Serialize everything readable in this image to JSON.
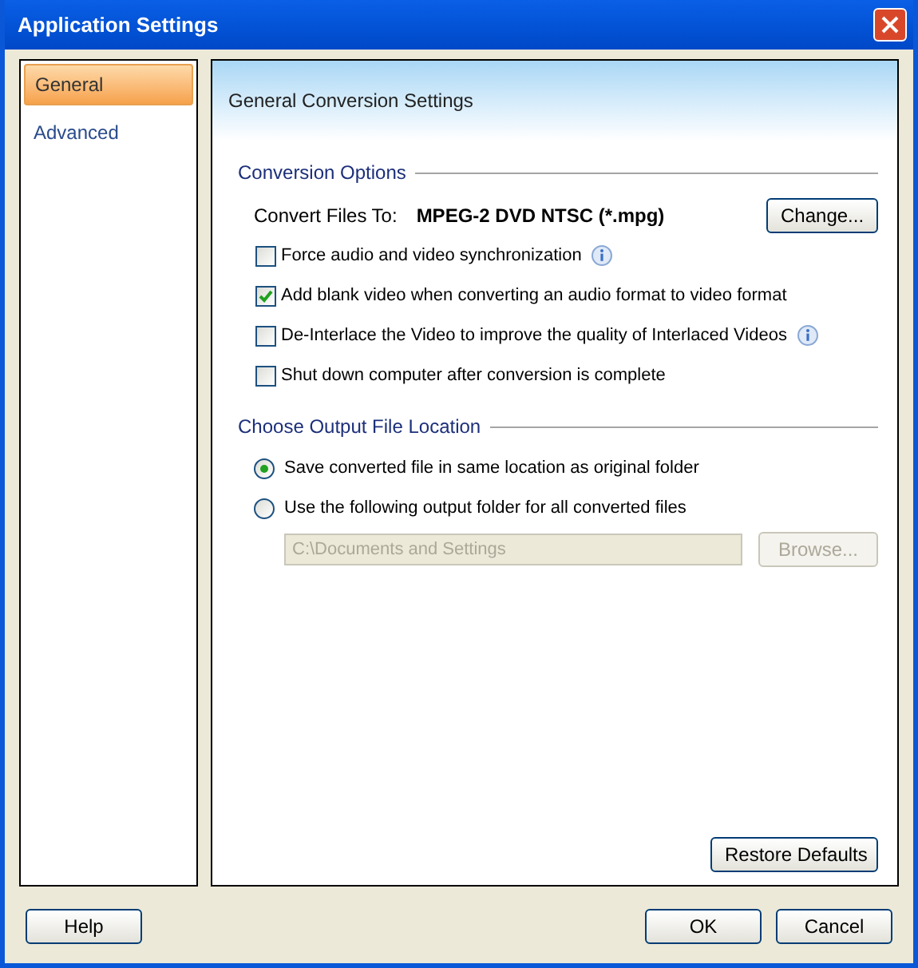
{
  "window": {
    "title": "Application Settings"
  },
  "sidebar": {
    "items": [
      {
        "label": "General",
        "selected": true
      },
      {
        "label": "Advanced",
        "selected": false
      }
    ]
  },
  "panel": {
    "title": "General Conversion Settings",
    "conversion_options": {
      "heading": "Conversion Options",
      "convert_label": "Convert Files To:",
      "convert_value": "MPEG-2 DVD NTSC (*.mpg)",
      "change_button": "Change...",
      "options": [
        {
          "label": "Force audio and video synchronization",
          "checked": false,
          "info": true
        },
        {
          "label": "Add blank video when converting an audio format to video format",
          "checked": true,
          "info": false
        },
        {
          "label": "De-Interlace the Video to improve the quality of Interlaced Videos",
          "checked": false,
          "info": true
        },
        {
          "label": "Shut down computer after conversion is complete",
          "checked": false,
          "info": false
        }
      ]
    },
    "output_location": {
      "heading": "Choose Output File Location",
      "choices": [
        {
          "label": "Save converted file in same location as original folder",
          "selected": true
        },
        {
          "label": "Use the following output folder for all converted files",
          "selected": false
        }
      ],
      "folder": {
        "value": "C:\\Documents and Settings",
        "disabled": true
      },
      "browse_button": {
        "label": "Browse...",
        "disabled": true
      }
    },
    "restore_button": "Restore Defaults"
  },
  "buttons": {
    "help": "Help",
    "ok": "OK",
    "cancel": "Cancel"
  }
}
